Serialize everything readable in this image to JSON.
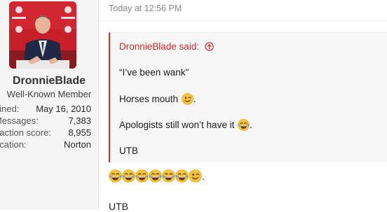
{
  "user": {
    "name": "DronnieBlade",
    "title": "Well-Known Member",
    "stats": [
      {
        "key": "oined:",
        "value": "May 16, 2010"
      },
      {
        "key": "Messages:",
        "value": "7,383"
      },
      {
        "key": "eaction score:",
        "value": "8,955"
      },
      {
        "key": "ocation:",
        "value": "Norton"
      }
    ]
  },
  "post": {
    "timestamp": "Today at 12:56 PM",
    "quote": {
      "author_label": "DronnieBlade said:",
      "lines": [
        {
          "text": "“I’ve been wank\"",
          "emoji": ""
        },
        {
          "text": "Horses mouth ",
          "emoji": "winking-face",
          "suffix": "."
        },
        {
          "text": "Apologists still won’t have it ",
          "emoji": "tears-of-joy",
          "suffix": "."
        },
        {
          "text": "UTB",
          "emoji": ""
        }
      ]
    },
    "reply_emojis": [
      "tears-of-joy",
      "tears-of-joy",
      "tears-of-joy",
      "tears-of-joy",
      "tears-of-joy",
      "tears-of-joy",
      "winking-face"
    ],
    "reply_suffix": ".",
    "closing": "UTB"
  },
  "colors": {
    "accent": "#d8282b",
    "sidebar_bg": "#f5f5f5",
    "quote_bg": "#f7f7f7"
  }
}
